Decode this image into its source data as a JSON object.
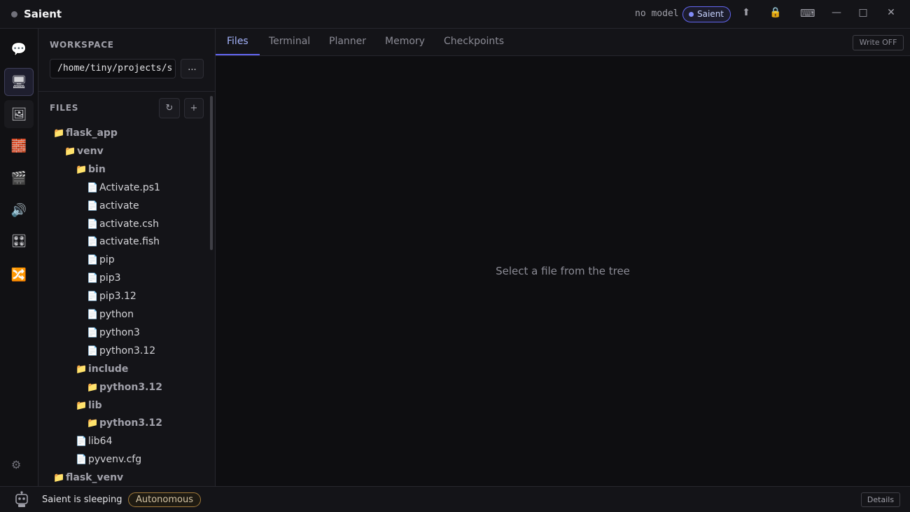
{
  "titlebar": {
    "app_name": "Saient",
    "model_label": "no model",
    "agent_pill": "Saient",
    "icons": [
      "upload-icon",
      "lock-icon",
      "keyboard-icon"
    ],
    "window_controls": [
      "minimize",
      "maximize",
      "close"
    ]
  },
  "rail": {
    "items": [
      {
        "name": "chat",
        "glyph": "💬"
      },
      {
        "name": "workspace",
        "glyph": "🖥"
      },
      {
        "name": "image",
        "glyph": "🖼"
      },
      {
        "name": "blocks",
        "glyph": "🧱"
      },
      {
        "name": "video",
        "glyph": "🎬"
      },
      {
        "name": "audio",
        "glyph": "🔊"
      },
      {
        "name": "apps",
        "glyph": "🎛"
      },
      {
        "name": "shuffle",
        "glyph": "🔀"
      }
    ],
    "settings_glyph": "⚙"
  },
  "sidebar": {
    "workspace_label": "WORKSPACE",
    "workspace_path": "/home/tiny/projects/s",
    "browse_label": "...",
    "files_label": "FILES",
    "refresh_glyph": "↻",
    "add_glyph": "+",
    "tree": [
      {
        "type": "folder",
        "name": "flask_app",
        "depth": 0
      },
      {
        "type": "folder",
        "name": "venv",
        "depth": 1
      },
      {
        "type": "folder",
        "name": "bin",
        "depth": 2
      },
      {
        "type": "file",
        "name": "Activate.ps1",
        "depth": 3
      },
      {
        "type": "file",
        "name": "activate",
        "depth": 3
      },
      {
        "type": "file",
        "name": "activate.csh",
        "depth": 3
      },
      {
        "type": "file",
        "name": "activate.fish",
        "depth": 3
      },
      {
        "type": "file",
        "name": "pip",
        "depth": 3
      },
      {
        "type": "file",
        "name": "pip3",
        "depth": 3
      },
      {
        "type": "file",
        "name": "pip3.12",
        "depth": 3
      },
      {
        "type": "file",
        "name": "python",
        "depth": 3
      },
      {
        "type": "file",
        "name": "python3",
        "depth": 3
      },
      {
        "type": "file",
        "name": "python3.12",
        "depth": 3
      },
      {
        "type": "folder",
        "name": "include",
        "depth": 2
      },
      {
        "type": "folder",
        "name": "python3.12",
        "depth": 3
      },
      {
        "type": "folder",
        "name": "lib",
        "depth": 2
      },
      {
        "type": "folder",
        "name": "python3.12",
        "depth": 3
      },
      {
        "type": "file",
        "name": "lib64",
        "depth": 2
      },
      {
        "type": "file",
        "name": "pyvenv.cfg",
        "depth": 2
      },
      {
        "type": "folder",
        "name": "flask_venv",
        "depth": 0
      }
    ]
  },
  "main": {
    "tabs": [
      {
        "label": "Files",
        "active": true
      },
      {
        "label": "Terminal",
        "active": false
      },
      {
        "label": "Planner",
        "active": false
      },
      {
        "label": "Memory",
        "active": false
      },
      {
        "label": "Checkpoints",
        "active": false
      }
    ],
    "write_toggle": "Write OFF",
    "empty_message": "Select a file from the tree"
  },
  "statusbar": {
    "status_text": "Saient is sleeping",
    "mode_pill": "Autonomous",
    "details_label": "Details"
  },
  "colors": {
    "accent": "#6366f1",
    "background": "#0e0e11",
    "panel": "#141418",
    "autonomous_border": "#a17a3a"
  }
}
